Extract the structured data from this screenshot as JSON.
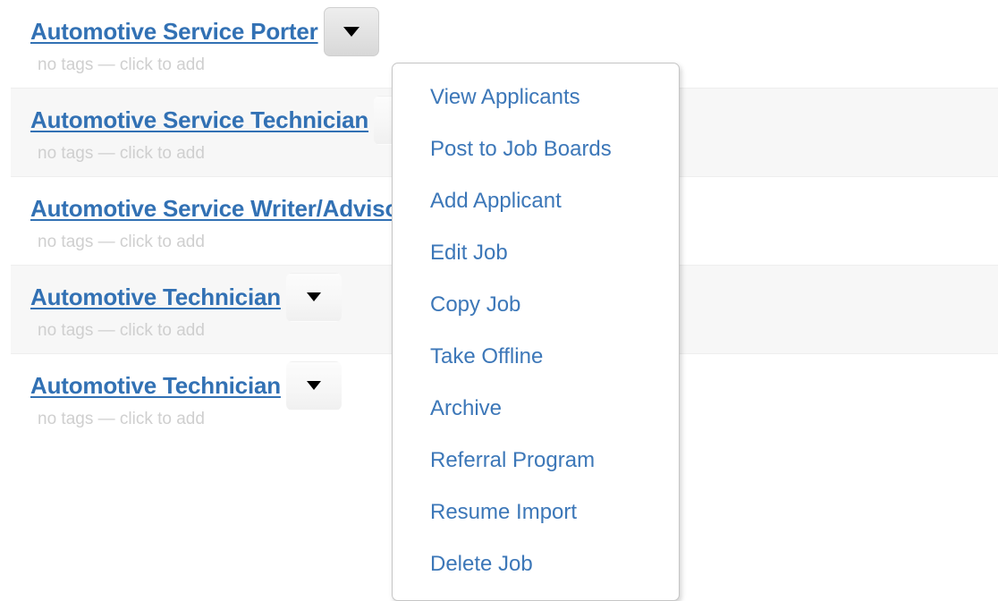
{
  "jobs": [
    {
      "title": "Automotive Service Porter",
      "tags": "no tags — click to add",
      "striped": false,
      "menu_open": true,
      "caret": "chevron-down-icon"
    },
    {
      "title": "Automotive Service Technician",
      "tags": "no tags — click to add",
      "striped": true,
      "menu_open": false,
      "caret": "chevron-down-icon"
    },
    {
      "title": "Automotive Service Writer/Advisor",
      "tags": "no tags — click to add",
      "striped": false,
      "menu_open": false,
      "caret": "chevron-down-icon"
    },
    {
      "title": "Automotive Technician",
      "tags": "no tags — click to add",
      "striped": true,
      "menu_open": false,
      "caret": "chevron-down-icon"
    },
    {
      "title": "Automotive Technician",
      "tags": "no tags — click to add",
      "striped": false,
      "menu_open": false,
      "caret": "chevron-down-icon"
    }
  ],
  "dropdown_menu": {
    "items": [
      {
        "label": "View Applicants"
      },
      {
        "label": "Post to Job Boards"
      },
      {
        "label": "Add Applicant"
      },
      {
        "label": "Edit Job"
      },
      {
        "label": "Copy Job"
      },
      {
        "label": "Take Offline"
      },
      {
        "label": "Archive"
      },
      {
        "label": "Referral Program"
      },
      {
        "label": "Resume Import"
      },
      {
        "label": "Delete Job"
      }
    ]
  },
  "colors": {
    "link_blue": "#3271b4",
    "menu_link_blue": "#3c77b8",
    "tag_placeholder_gray": "#cfcfcf",
    "stripe_background": "#f7f7f7",
    "row_divider": "#eeeeee",
    "menu_border": "#c6c6c6",
    "page_background": "#ffffff"
  }
}
